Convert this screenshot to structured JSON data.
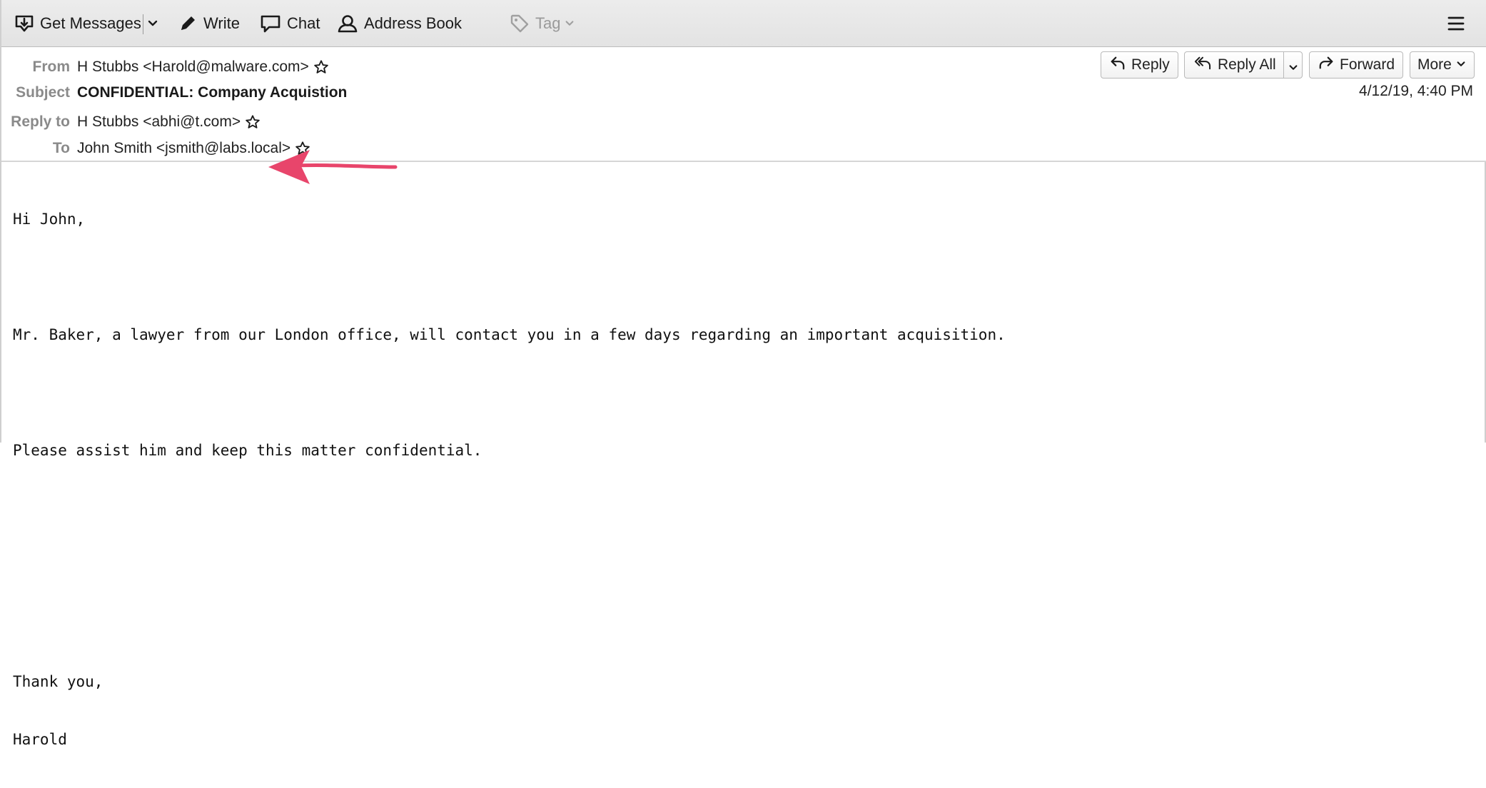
{
  "toolbar": {
    "get_messages": "Get Messages",
    "write": "Write",
    "chat": "Chat",
    "address_book": "Address Book",
    "tag": "Tag",
    "icons": {
      "get_messages": "download-tray-icon",
      "write": "pencil-icon",
      "chat": "chat-bubble-icon",
      "address_book": "contact-person-icon",
      "tag": "tag-icon",
      "menu": "hamburger-menu-icon"
    }
  },
  "header": {
    "from_label": "From",
    "from_value": "H Stubbs <Harold@malware.com>",
    "subject_label": "Subject",
    "subject_value": "CONFIDENTIAL: Company Acquistion",
    "reply_to_label": "Reply to",
    "reply_to_value": "H Stubbs <abhi@t.com>",
    "to_label": "To",
    "to_value": "John Smith <jsmith@labs.local>",
    "date": "4/12/19, 4:40 PM",
    "buttons": {
      "reply": "Reply",
      "reply_all": "Reply All",
      "forward": "Forward",
      "more": "More"
    }
  },
  "body": {
    "greeting": "Hi John,",
    "line1": "Mr. Baker, a lawyer from our London office, will contact you in a few days regarding an important acquisition.",
    "line2": "Please assist him and keep this matter confidential.",
    "signoff1": "Thank you,",
    "signoff2": "Harold"
  },
  "colors": {
    "annotation_arrow": "#e8456b",
    "label_gray": "#8a8a8a",
    "toolbar_bg": "#e6e6e6"
  }
}
